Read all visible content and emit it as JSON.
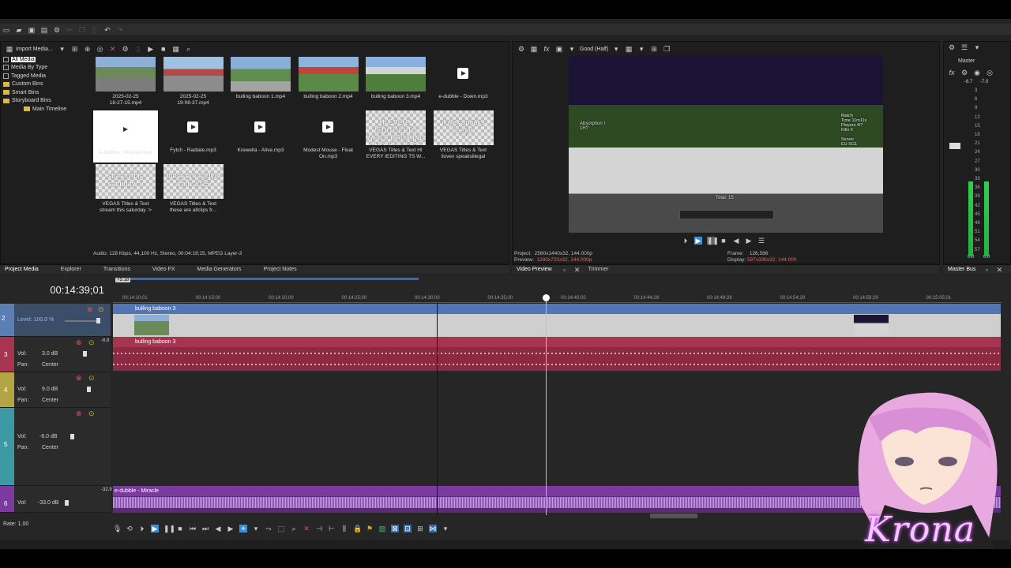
{
  "toolbar": {
    "icons": [
      "new-icon",
      "open-icon",
      "save-icon",
      "save-as-icon",
      "properties-icon",
      "cut-icon",
      "copy-icon",
      "paste-icon",
      "undo-icon",
      "redo-icon"
    ]
  },
  "project_media": {
    "import_label": "Import Media...",
    "tree": [
      {
        "label": "All Media",
        "selected": true
      },
      {
        "label": "Media By Type"
      },
      {
        "label": "Tagged Media"
      },
      {
        "label": "Custom Bins"
      },
      {
        "label": "Smart Bins"
      },
      {
        "label": "Storyboard Bins"
      },
      {
        "label": "Main Timeline"
      }
    ],
    "items": [
      {
        "label": "2025-02-25\n18-27-15.mp4",
        "kind": "mc1"
      },
      {
        "label": "2025-02-25\n19-08-37.mp4",
        "kind": "mc2"
      },
      {
        "label": "bulling baboon 1.mp4",
        "kind": "mc3"
      },
      {
        "label": "bulling baboon 2.mp4",
        "kind": "mc4"
      },
      {
        "label": "bulling baboon 3.mp4",
        "kind": "mc5"
      },
      {
        "label": "e-dubble - Down.mp3",
        "kind": "audio"
      },
      {
        "label": "e-dubble - Miracle.mp3",
        "kind": "audio",
        "selected": true
      },
      {
        "label": "Fytch - Radiate.mp3",
        "kind": "audio"
      },
      {
        "label": "Krewella - Alive.mp3",
        "kind": "audio"
      },
      {
        "label": "Modest Mouse - Float\nOn.mp3",
        "kind": "audio"
      },
      {
        "label": "VEGAS Titles & Text HI\nEVERY IEDITING TS W...",
        "kind": "check",
        "overlay": "HI EVERY IEDITING TS WHILE DRINKING ENOUGH THEY ALL W..."
      },
      {
        "label": "VEGAS Titles & Text\nilovex speaksillegal",
        "kind": "check",
        "overlay": "ilovex speaks illegal"
      },
      {
        "label": "VEGAS Titles & Text\nstream this saturday :>",
        "kind": "check",
        "overlay": "stream this saturday :>"
      },
      {
        "label": "VEGAS Titles & Text\nthese are allclips fr...",
        "kind": "check",
        "overlay": "these are allclips from 2025"
      }
    ],
    "status": "Audio: 128 Kbps, 44,100 Hz, Stereo, 00:04:19;15, MPEG Layer-3"
  },
  "left_tabs": [
    "Project Media",
    "Explorer",
    "Transitions",
    "Video FX",
    "Media Generators",
    "Project Notes"
  ],
  "preview": {
    "quality": "Good (Half)",
    "hud_left": "Absorption I\n1H?",
    "hud_right": "Match\nTime 11m11s\nPlayers 4/7\nKills 0\n\nServer\nEU SG1",
    "hud_total": "Total: 15",
    "project_label": "Project:",
    "project_value": "2560x1440x32, 144.000p",
    "preview_label": "Preview:",
    "preview_value": "1280x720x32, 144.000p",
    "frame_label": "Frame:",
    "frame_value": "126,586",
    "display_label": "Display:",
    "display_value": "597x336x32, 144.000",
    "tabs": [
      "Video Preview",
      "Trimmer"
    ]
  },
  "master": {
    "title": "Master",
    "peak_left": "-6.7",
    "peak_right": "-7.0",
    "scale": [
      "3",
      "6",
      "9",
      "12",
      "15",
      "18",
      "21",
      "24",
      "27",
      "30",
      "33",
      "36",
      "39",
      "42",
      "45",
      "48",
      "51",
      "54",
      "57"
    ],
    "bottom_left": "0.0",
    "bottom_right": "0.0",
    "tab": "Master Bus"
  },
  "timeline": {
    "timecode": "00:14:39;01",
    "marker": "+5:18",
    "ruler": [
      "00:14:10;01",
      "00:14:15;00",
      "00:14:20;00",
      "00:14:25;00",
      "00:14:30;00",
      "00:14:35;00",
      "00:14:40;00",
      "00:14:44;29",
      "00:14:49;29",
      "00:14:54;29",
      "00:14:59;29",
      "00:15:05;01"
    ],
    "tracks": [
      {
        "num": "2",
        "type": "video",
        "level": "Level: 100.0 %",
        "event": "bulling baboon 3"
      },
      {
        "num": "3",
        "type": "audio",
        "vol": "3.0 dB",
        "pan": "Center",
        "event": "bulling baboon 3",
        "peak": "-6.8"
      },
      {
        "num": "4",
        "type": "audio",
        "vol": "9.0 dB",
        "pan": "Center"
      },
      {
        "num": "5",
        "type": "audio",
        "vol": "-6.0 dB",
        "pan": "Center"
      },
      {
        "num": "6",
        "type": "audio",
        "vol": "-33.0 dB",
        "event": "e-dubble - Miracle",
        "peak": "-32.9"
      }
    ],
    "vol_label": "Vol:",
    "pan_label": "Pan:",
    "rate": "Rate: 1.00"
  },
  "overlay": {
    "name": "Krona"
  },
  "colors": {
    "video_track": "#5276b3",
    "audio_track": "#a63552",
    "music_track": "#7a3a9e",
    "meter": "#2fcf4f"
  }
}
